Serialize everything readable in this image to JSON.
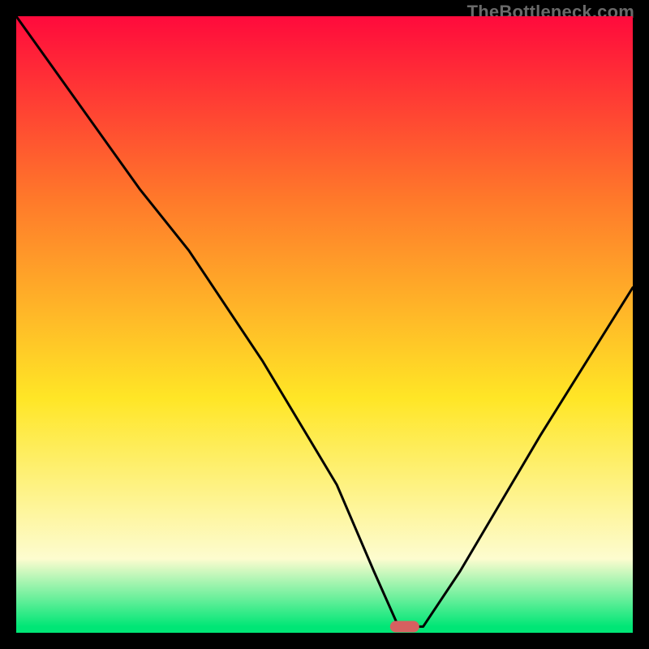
{
  "watermark": "TheBottleneck.com",
  "colors": {
    "top": "#ff0a3c",
    "orange": "#ff7a2a",
    "yellow": "#ffe626",
    "lightyellow": "#fdfccf",
    "green": "#00e676",
    "curve": "#000000",
    "marker": "#d66060",
    "background": "#000000"
  },
  "chart_data": {
    "type": "line",
    "title": "",
    "xlabel": "",
    "ylabel": "",
    "xlim": [
      0,
      100
    ],
    "ylim": [
      0,
      100
    ],
    "series": [
      {
        "name": "bottleneck-curve",
        "x": [
          0,
          10,
          20,
          28,
          40,
          52,
          58,
          62,
          66,
          72,
          85,
          100
        ],
        "values": [
          100,
          86,
          72,
          62,
          44,
          24,
          10,
          1,
          1,
          10,
          32,
          56
        ]
      }
    ],
    "marker": {
      "x": 63,
      "y": 1
    },
    "gradient_stops": [
      {
        "pos": 0.0,
        "color": "#ff0a3c"
      },
      {
        "pos": 0.3,
        "color": "#ff7a2a"
      },
      {
        "pos": 0.62,
        "color": "#ffe626"
      },
      {
        "pos": 0.88,
        "color": "#fdfccf"
      },
      {
        "pos": 0.99,
        "color": "#00e676"
      }
    ]
  }
}
